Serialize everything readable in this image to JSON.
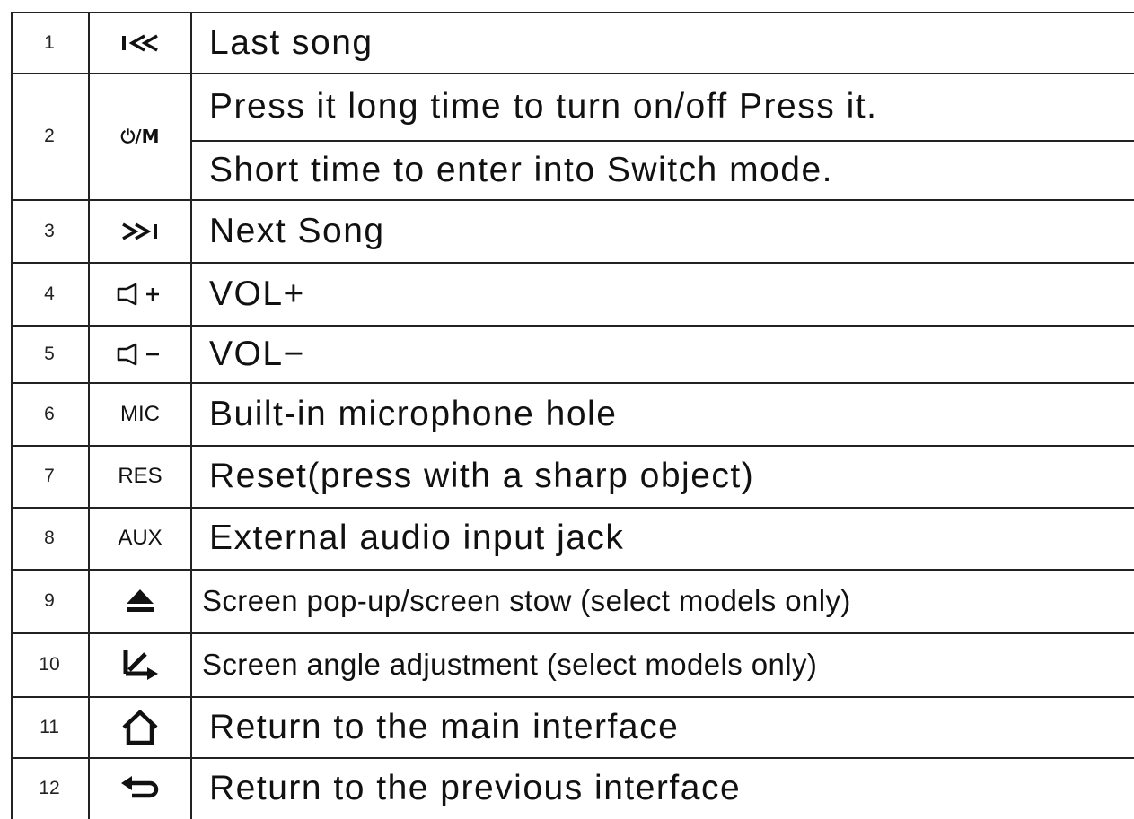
{
  "rows": [
    {
      "num": "1",
      "key_icon": "previous-track-icon",
      "desc": "Last song"
    },
    {
      "num": "2",
      "key": "⏻/M",
      "key_icon": "power-mode-icon",
      "desc_lines": [
        "Press it long time to turn on/off Press it.",
        "Short time to enter into Switch mode."
      ]
    },
    {
      "num": "3",
      "key_icon": "next-track-icon",
      "desc": "Next Song"
    },
    {
      "num": "4",
      "key_icon": "volume-up-icon",
      "desc": "VOL+"
    },
    {
      "num": "5",
      "key_icon": "volume-down-icon",
      "desc": "VOL−"
    },
    {
      "num": "6",
      "key": "MIC",
      "desc": "Built-in microphone hole"
    },
    {
      "num": "7",
      "key": "RES",
      "desc": "Reset(press with a sharp object)"
    },
    {
      "num": "8",
      "key": "AUX",
      "desc": "External audio input jack"
    },
    {
      "num": "9",
      "key_icon": "eject-icon",
      "desc": "Screen pop-up/screen stow (select models only)"
    },
    {
      "num": "10",
      "key_icon": "screen-angle-icon",
      "desc": "Screen angle adjustment (select models only)"
    },
    {
      "num": "11",
      "key_icon": "home-icon",
      "desc": "Return to the main interface"
    },
    {
      "num": "12",
      "key_icon": "back-arrow-icon",
      "desc": "Return to the previous interface"
    }
  ]
}
